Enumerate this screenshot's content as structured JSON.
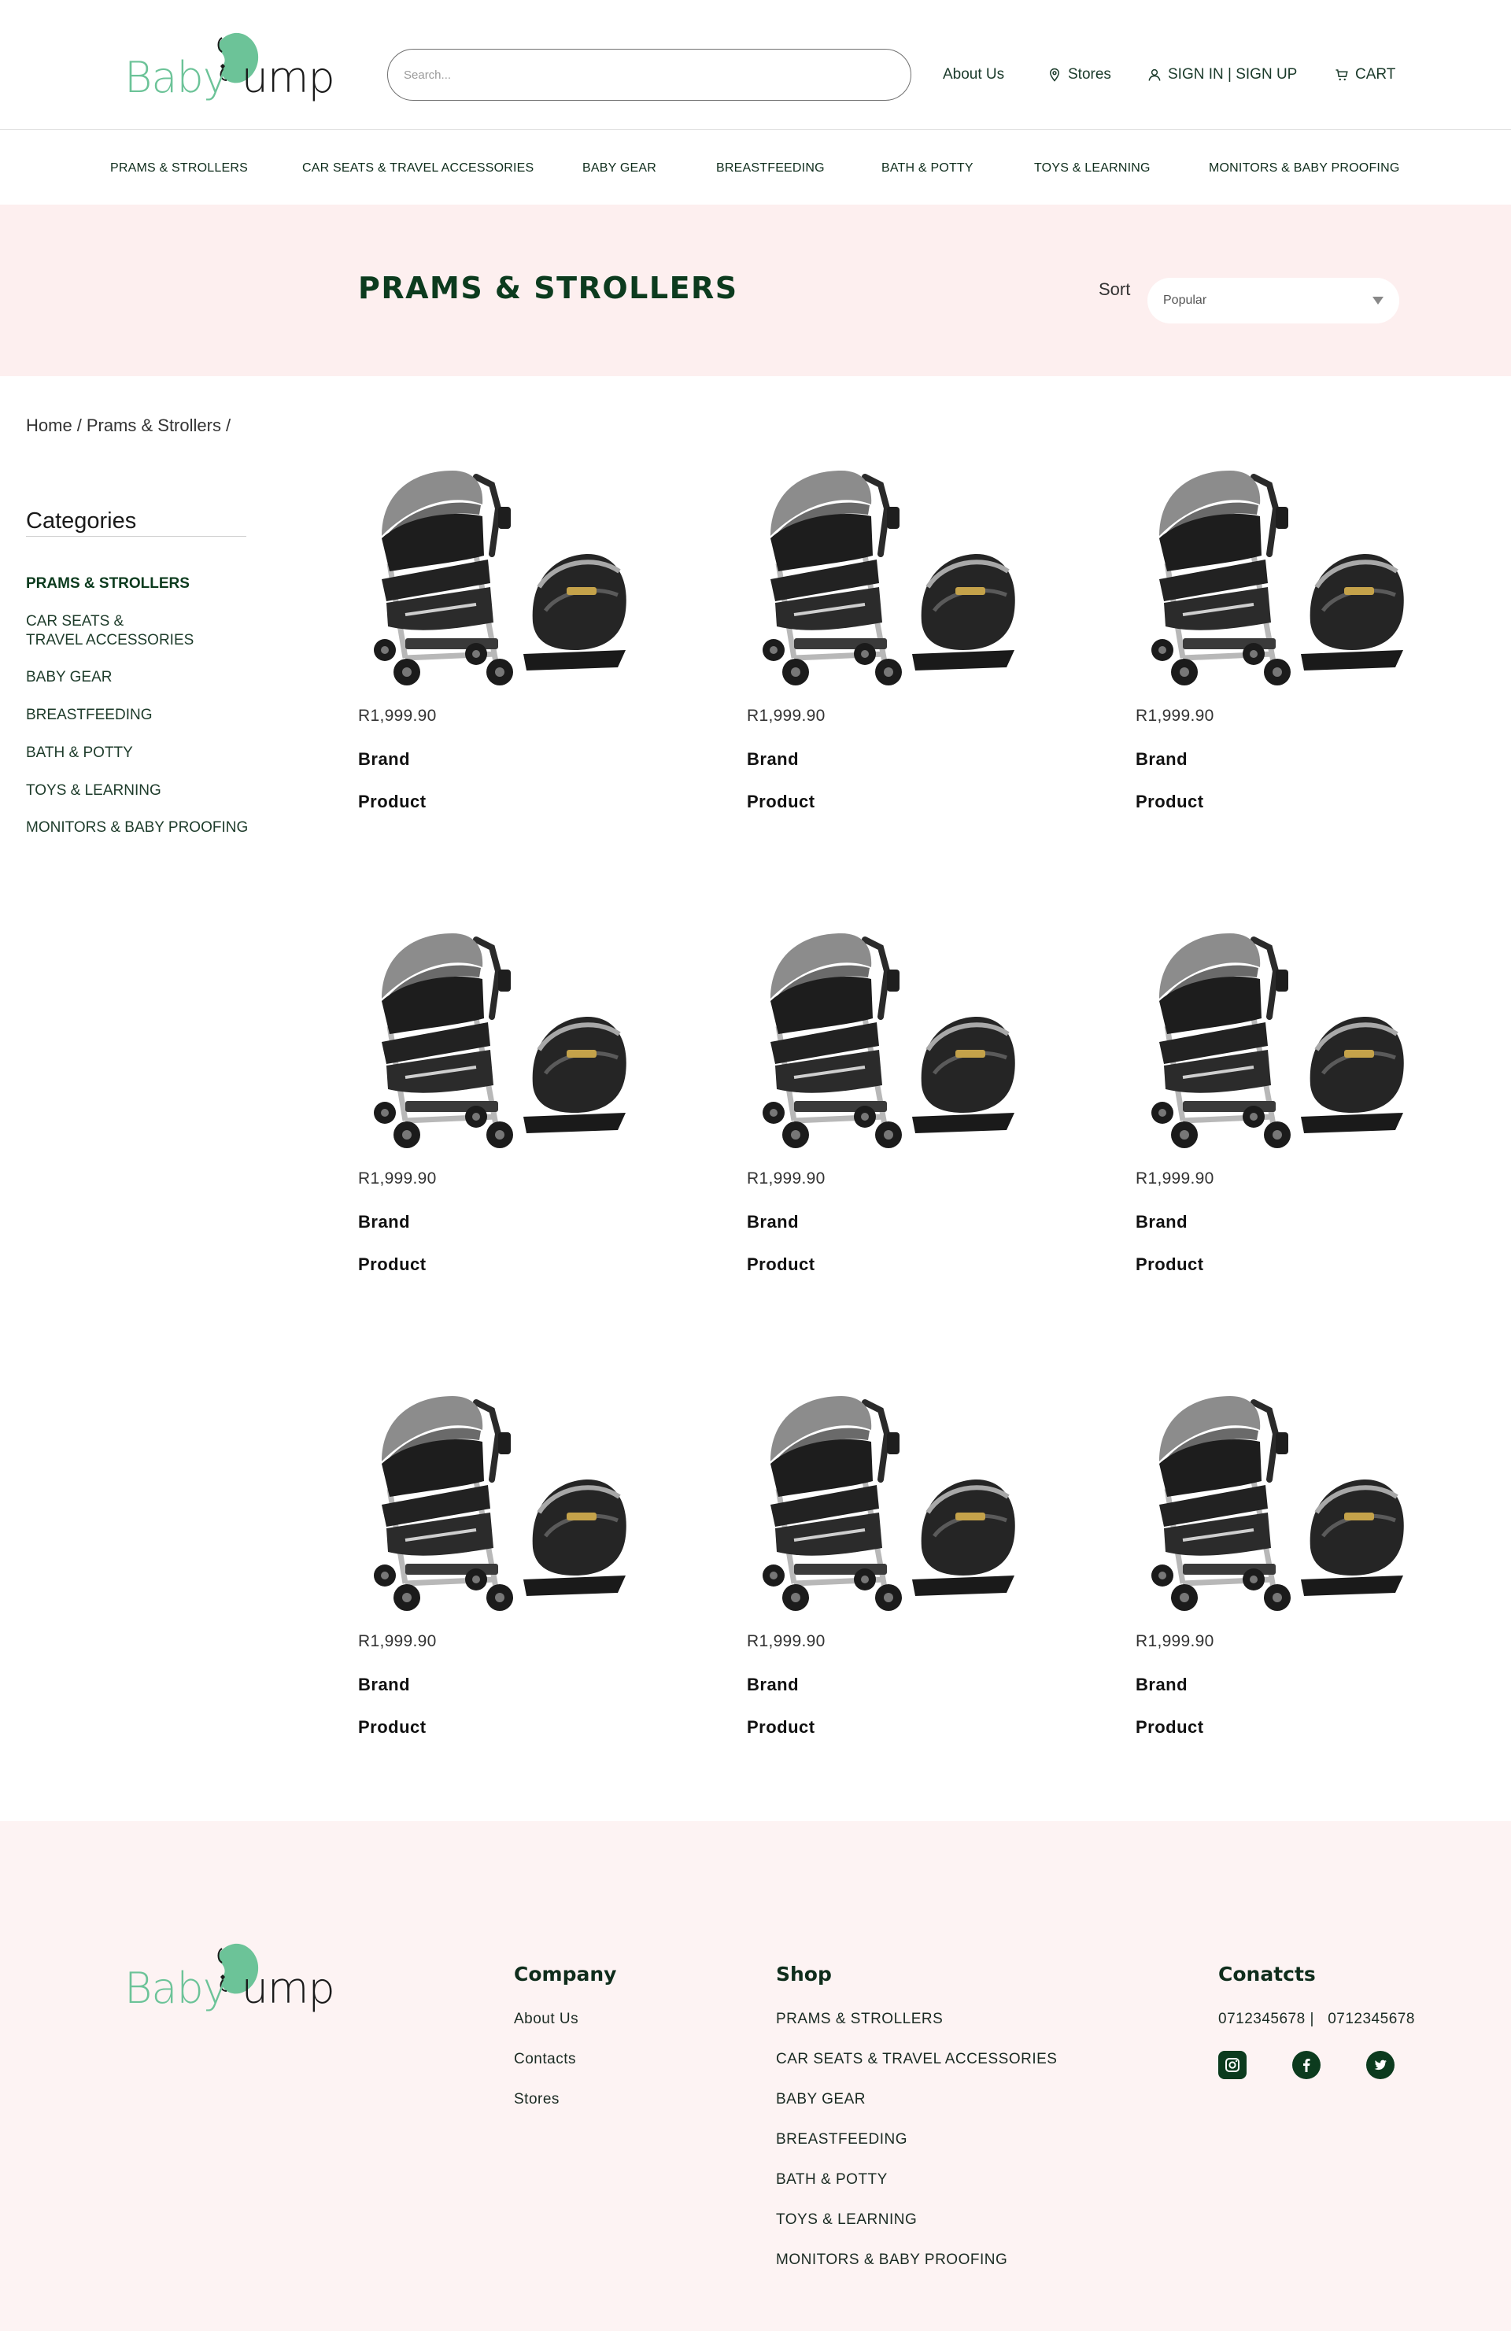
{
  "brand": {
    "logo_part1": "Baby",
    "logo_part2": "ump"
  },
  "header": {
    "search_placeholder": "Search...",
    "about": "About Us",
    "stores": "Stores",
    "signin": "SIGN IN | SIGN UP",
    "cart": "CART"
  },
  "category_nav": [
    "PRAMS & STROLLERS",
    "CAR SEATS & TRAVEL ACCESSORIES",
    "BABY GEAR",
    "BREASTFEEDING",
    "BATH & POTTY",
    "TOYS & LEARNING",
    "MONITORS & BABY PROOFING"
  ],
  "hero": {
    "title": "PRAMS & STROLLERS",
    "sort_label": "Sort",
    "sort_value": "Popular"
  },
  "breadcrumb": [
    "Home",
    "/",
    "Prams & Strollers",
    "/"
  ],
  "sidebar": {
    "title": "Categories",
    "items": [
      "PRAMS & STROLLERS",
      "CAR SEATS &\nTRAVEL ACCESSORIES",
      "BABY GEAR",
      "BREASTFEEDING",
      "BATH & POTTY",
      "TOYS & LEARNING",
      "MONITORS & BABY PROOFING"
    ]
  },
  "products": [
    {
      "price": "R1,999.90",
      "brand": "Brand",
      "name": "Product"
    },
    {
      "price": "R1,999.90",
      "brand": "Brand",
      "name": "Product"
    },
    {
      "price": "R1,999.90",
      "brand": "Brand",
      "name": "Product"
    },
    {
      "price": "R1,999.90",
      "brand": "Brand",
      "name": "Product"
    },
    {
      "price": "R1,999.90",
      "brand": "Brand",
      "name": "Product"
    },
    {
      "price": "R1,999.90",
      "brand": "Brand",
      "name": "Product"
    },
    {
      "price": "R1,999.90",
      "brand": "Brand",
      "name": "Product"
    },
    {
      "price": "R1,999.90",
      "brand": "Brand",
      "name": "Product"
    },
    {
      "price": "R1,999.90",
      "brand": "Brand",
      "name": "Product"
    }
  ],
  "footer": {
    "company": {
      "title": "Company",
      "links": [
        "About Us",
        "Contacts",
        "Stores"
      ]
    },
    "shop": {
      "title": "Shop",
      "links": [
        "PRAMS & STROLLERS",
        "CAR SEATS & TRAVEL ACCESSORIES",
        "BABY GEAR",
        "BREASTFEEDING",
        "BATH & POTTY",
        "TOYS & LEARNING",
        "MONITORS & BABY PROOFING"
      ]
    },
    "contacts": {
      "title": "Conatcts",
      "phones": "0712345678 |   0712345678"
    }
  },
  "icons": {
    "stores": "map-pin-icon",
    "signin": "user-icon",
    "cart": "cart-icon",
    "sort": "caret-down-icon",
    "socials": [
      "instagram-icon",
      "facebook-icon",
      "twitter-icon"
    ]
  },
  "colors": {
    "primary_dark_green": "#0c3b1e",
    "logo_green": "#6cc398",
    "hero_bg": "#fdefef",
    "footer_bg": "#fdf3f3"
  }
}
